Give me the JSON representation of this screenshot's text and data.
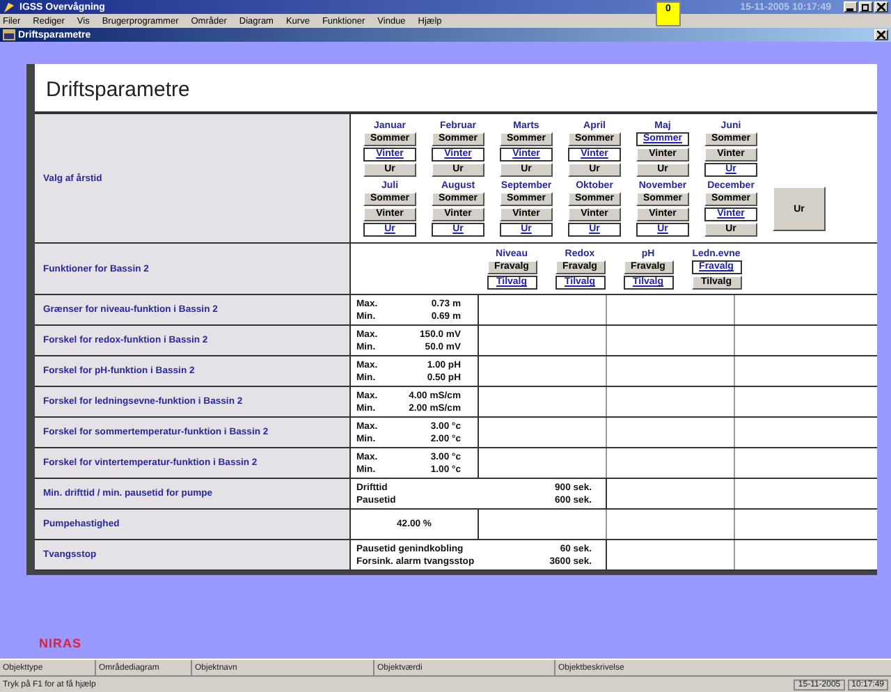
{
  "app": {
    "title": "IGSS Overvågning",
    "indicator": "0",
    "clock": "15-11-2005 10:17:49"
  },
  "menu": [
    "Filer",
    "Rediger",
    "Vis",
    "Brugerprogrammer",
    "Områder",
    "Diagram",
    "Kurve",
    "Funktioner",
    "Vindue",
    "Hjælp"
  ],
  "child_window": {
    "title": "Driftsparametre"
  },
  "heading": "Driftsparametre",
  "season": {
    "label": "Valg af årstid",
    "clock_button": "Ur",
    "months": [
      {
        "name": "Januar",
        "options": [
          {
            "label": "Sommer",
            "selected": false
          },
          {
            "label": "Vinter",
            "selected": true
          },
          {
            "label": "Ur",
            "selected": false
          }
        ]
      },
      {
        "name": "Februar",
        "options": [
          {
            "label": "Sommer",
            "selected": false
          },
          {
            "label": "Vinter",
            "selected": true
          },
          {
            "label": "Ur",
            "selected": false
          }
        ]
      },
      {
        "name": "Marts",
        "options": [
          {
            "label": "Sommer",
            "selected": false
          },
          {
            "label": "Vinter",
            "selected": true
          },
          {
            "label": "Ur",
            "selected": false
          }
        ]
      },
      {
        "name": "April",
        "options": [
          {
            "label": "Sommer",
            "selected": false
          },
          {
            "label": "Vinter",
            "selected": true
          },
          {
            "label": "Ur",
            "selected": false
          }
        ]
      },
      {
        "name": "Maj",
        "options": [
          {
            "label": "Sommer",
            "selected": true
          },
          {
            "label": "Vinter",
            "selected": false
          },
          {
            "label": "Ur",
            "selected": false
          }
        ]
      },
      {
        "name": "Juni",
        "options": [
          {
            "label": "Sommer",
            "selected": false
          },
          {
            "label": "Vinter",
            "selected": false
          },
          {
            "label": "Ur",
            "selected": true
          }
        ]
      },
      {
        "name": "Juli",
        "options": [
          {
            "label": "Sommer",
            "selected": false
          },
          {
            "label": "Vinter",
            "selected": false
          },
          {
            "label": "Ur",
            "selected": true
          }
        ]
      },
      {
        "name": "August",
        "options": [
          {
            "label": "Sommer",
            "selected": false
          },
          {
            "label": "Vinter",
            "selected": false
          },
          {
            "label": "Ur",
            "selected": true
          }
        ]
      },
      {
        "name": "September",
        "options": [
          {
            "label": "Sommer",
            "selected": false
          },
          {
            "label": "Vinter",
            "selected": false
          },
          {
            "label": "Ur",
            "selected": true
          }
        ]
      },
      {
        "name": "Oktober",
        "options": [
          {
            "label": "Sommer",
            "selected": false
          },
          {
            "label": "Vinter",
            "selected": false
          },
          {
            "label": "Ur",
            "selected": true
          }
        ]
      },
      {
        "name": "November",
        "options": [
          {
            "label": "Sommer",
            "selected": false
          },
          {
            "label": "Vinter",
            "selected": false
          },
          {
            "label": "Ur",
            "selected": true
          }
        ]
      },
      {
        "name": "December",
        "options": [
          {
            "label": "Sommer",
            "selected": false
          },
          {
            "label": "Vinter",
            "selected": true
          },
          {
            "label": "Ur",
            "selected": false
          }
        ]
      }
    ]
  },
  "functions": {
    "label": "Funktioner for Bassin 2",
    "items": [
      {
        "name": "Niveau",
        "options": [
          {
            "label": "Fravalg",
            "selected": false
          },
          {
            "label": "Tilvalg",
            "selected": true
          }
        ]
      },
      {
        "name": "Redox",
        "options": [
          {
            "label": "Fravalg",
            "selected": false
          },
          {
            "label": "Tilvalg",
            "selected": true
          }
        ]
      },
      {
        "name": "pH",
        "options": [
          {
            "label": "Fravalg",
            "selected": false
          },
          {
            "label": "Tilvalg",
            "selected": true
          }
        ]
      },
      {
        "name": "Ledn.evne",
        "options": [
          {
            "label": "Fravalg",
            "selected": true
          },
          {
            "label": "Tilvalg",
            "selected": false
          }
        ]
      }
    ]
  },
  "rows": [
    {
      "kind": "limits",
      "label": "Grænser for niveau-funktion i Bassin 2",
      "lines": [
        {
          "name": "Max.",
          "value": "0.73 m"
        },
        {
          "name": "Min.",
          "value": "0.69 m"
        }
      ]
    },
    {
      "kind": "limits",
      "label": "Forskel for redox-funktion i Bassin 2",
      "lines": [
        {
          "name": "Max.",
          "value": "150.0 mV"
        },
        {
          "name": "Min.",
          "value": "50.0 mV"
        }
      ]
    },
    {
      "kind": "limits",
      "label": "Forskel for pH-funktion i Bassin 2",
      "lines": [
        {
          "name": "Max.",
          "value": "1.00 pH"
        },
        {
          "name": "Min.",
          "value": "0.50 pH"
        }
      ]
    },
    {
      "kind": "limits",
      "label": "Forskel for ledningsevne-funktion i Bassin 2",
      "lines": [
        {
          "name": "Max.",
          "value": "4.00 mS/cm"
        },
        {
          "name": "Min.",
          "value": "2.00 mS/cm"
        }
      ]
    },
    {
      "kind": "limits",
      "label": "Forskel for sommertemperatur-funktion i Bassin 2",
      "lines": [
        {
          "name": "Max.",
          "value": "3.00 °c"
        },
        {
          "name": "Min.",
          "value": "2.00 °c"
        }
      ]
    },
    {
      "kind": "limits",
      "label": "Forskel for vintertemperatur-funktion i Bassin 2",
      "lines": [
        {
          "name": "Max.",
          "value": "3.00 °c"
        },
        {
          "name": "Min.",
          "value": "1.00 °c"
        }
      ]
    },
    {
      "kind": "wide",
      "label": "Min. drifttid / min. pausetid for pumpe",
      "lines": [
        {
          "name": "Drifttid",
          "value": "900 sek."
        },
        {
          "name": "Pausetid",
          "value": "600 sek."
        }
      ]
    },
    {
      "kind": "single",
      "label": "Pumpehastighed",
      "lines": [
        {
          "value": "42.00 %"
        }
      ]
    },
    {
      "kind": "wide",
      "label": "Tvangsstop",
      "lines": [
        {
          "name": "Pausetid genindkobling",
          "value": "60 sek."
        },
        {
          "name": "Forsink. alarm tvangsstop",
          "value": "3600 sek."
        }
      ]
    }
  ],
  "logo": "NIRAS",
  "status_fields": [
    "Objekttype",
    "Områdediagram",
    "Objektnavn",
    "Objektværdi",
    "Objektbeskrivelse"
  ],
  "status_bar": {
    "hint": "Tryk på F1 for at få hjælp",
    "date": "15-11-2005",
    "time": "10:17:49"
  }
}
